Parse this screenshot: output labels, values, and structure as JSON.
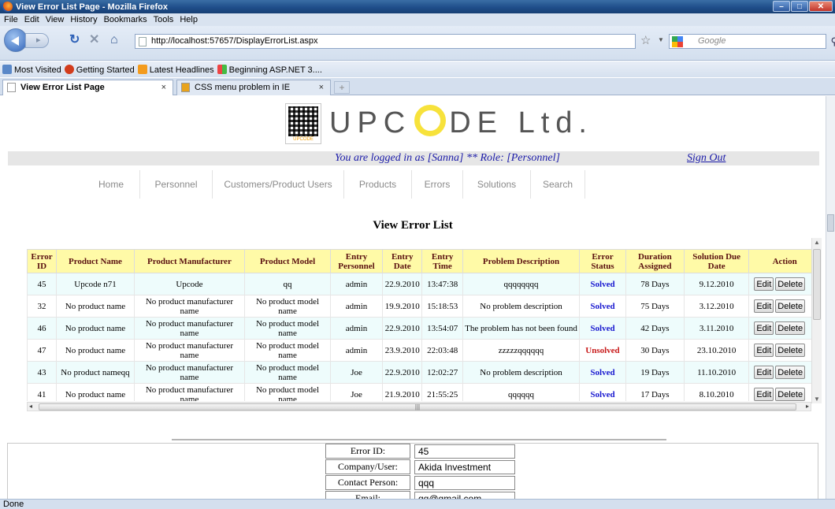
{
  "browser": {
    "window_title": "View Error List Page - Mozilla Firefox",
    "menu": [
      "File",
      "Edit",
      "View",
      "History",
      "Bookmarks",
      "Tools",
      "Help"
    ],
    "url": "http://localhost:57657/DisplayErrorList.aspx",
    "search_placeholder": "Google",
    "bookmarks": [
      "Most Visited",
      "Getting Started",
      "Latest Headlines",
      "Beginning ASP.NET 3...."
    ],
    "tabs": [
      {
        "label": "View Error List Page",
        "active": true
      },
      {
        "label": "CSS menu problem in IE",
        "active": false
      }
    ],
    "status": "Done"
  },
  "page": {
    "logo_text": "UPC",
    "logo_text2": "DE Ltd.",
    "logo_badge": "UPCODE",
    "login_text": "You are logged in as [Sanna] ** Role: [Personnel]",
    "signout_label": "Sign Out",
    "nav": [
      "Home",
      "Personnel",
      "Customers/Product Users",
      "Products",
      "Errors",
      "Solutions",
      "Search"
    ],
    "title": "View Error List"
  },
  "grid": {
    "columns": [
      "Error ID",
      "Product Name",
      "Product Manufacturer",
      "Product Model",
      "Entry Personnel",
      "Entry Date",
      "Entry Time",
      "Problem Description",
      "Error Status",
      "Duration Assigned",
      "Solution Due Date",
      "Action"
    ],
    "edit_label": "Edit",
    "delete_label": "Delete",
    "rows": [
      {
        "id": "45",
        "product": "Upcode n71",
        "manufacturer": "Upcode",
        "model": "qq",
        "personnel": "admin",
        "date": "22.9.2010",
        "time": "13:47:38",
        "description": "qqqqqqqq",
        "status": "Solved",
        "duration": "78 Days",
        "due": "9.12.2010"
      },
      {
        "id": "32",
        "product": "No product name",
        "manufacturer": "No product manufacturer name",
        "model": "No product model name",
        "personnel": "admin",
        "date": "19.9.2010",
        "time": "15:18:53",
        "description": "No problem description",
        "status": "Solved",
        "duration": "75 Days",
        "due": "3.12.2010"
      },
      {
        "id": "46",
        "product": "No product name",
        "manufacturer": "No product manufacturer name",
        "model": "No product model name",
        "personnel": "admin",
        "date": "22.9.2010",
        "time": "13:54:07",
        "description": "The problem has not been found",
        "status": "Solved",
        "duration": "42 Days",
        "due": "3.11.2010"
      },
      {
        "id": "47",
        "product": "No product name",
        "manufacturer": "No product manufacturer name",
        "model": "No product model name",
        "personnel": "admin",
        "date": "23.9.2010",
        "time": "22:03:48",
        "description": "zzzzzqqqqqq",
        "status": "Unsolved",
        "duration": "30 Days",
        "due": "23.10.2010"
      },
      {
        "id": "43",
        "product": "No product nameqq",
        "manufacturer": "No product manufacturer name",
        "model": "No product model name",
        "personnel": "Joe",
        "date": "22.9.2010",
        "time": "12:02:27",
        "description": "No problem description",
        "status": "Solved",
        "duration": "19 Days",
        "due": "11.10.2010"
      },
      {
        "id": "41",
        "product": "No product name",
        "manufacturer": "No product manufacturer name",
        "model": "No product model name",
        "personnel": "Joe",
        "date": "21.9.2010",
        "time": "21:55:25",
        "description": "qqqqqq",
        "status": "Solved",
        "duration": "17 Days",
        "due": "8.10.2010"
      }
    ]
  },
  "detail": {
    "fields": [
      {
        "label": "Error ID:",
        "value": "45"
      },
      {
        "label": "Company/User:",
        "value": "Akida Investment"
      },
      {
        "label": "Contact Person:",
        "value": "qqq"
      },
      {
        "label": "Email:",
        "value": "qq@gmail.com"
      }
    ]
  },
  "colors": {
    "header_bg": "#fffaa7",
    "header_text": "#5a1010",
    "solved": "#1a1ad0",
    "unsolved": "#c81a1a",
    "login_text": "#1a1aa8",
    "row_alt": "#eefcfc"
  }
}
